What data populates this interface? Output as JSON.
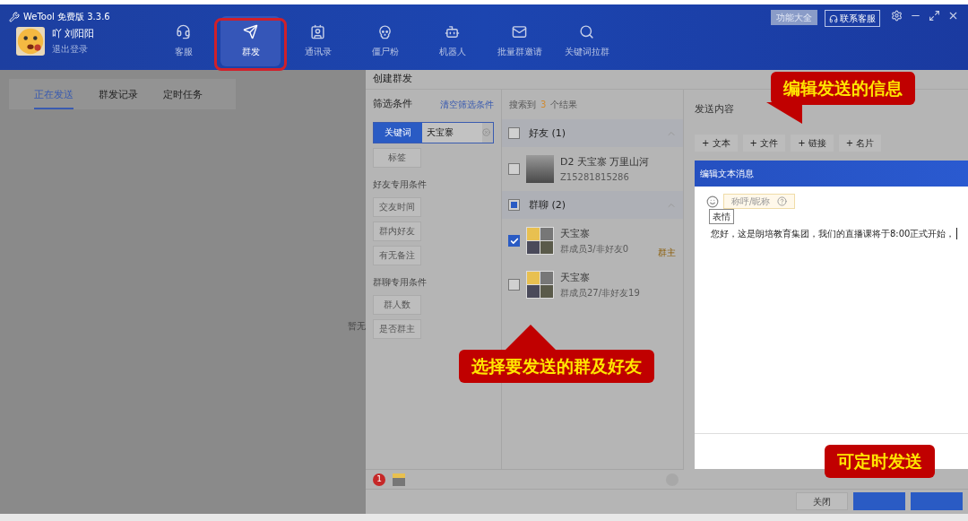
{
  "window": {
    "title": "WeTool 免费版 3.3.6"
  },
  "user": {
    "name": "吖 刘阳阳",
    "logout": "退出登录"
  },
  "nav": [
    {
      "label": "客服",
      "selected": false
    },
    {
      "label": "群发",
      "selected": true
    },
    {
      "label": "通讯录",
      "selected": false
    },
    {
      "label": "僵尸粉",
      "selected": false
    },
    {
      "label": "机器人",
      "selected": false
    },
    {
      "label": "批量群邀请",
      "selected": false
    },
    {
      "label": "关键词拉群",
      "selected": false
    }
  ],
  "header_buttons": {
    "features": "功能大全",
    "support": "联系客服"
  },
  "left_tabs": [
    {
      "label": "正在发送",
      "selected": true
    },
    {
      "label": "群发记录",
      "selected": false
    },
    {
      "label": "定时任务",
      "selected": false
    }
  ],
  "empty_text": "暂无",
  "panel": {
    "title": "创建群发"
  },
  "filters": {
    "title": "筛选条件",
    "clear": "清空筛选条件",
    "keyword": {
      "label": "关键词",
      "value": "天宝寨"
    },
    "tag": "标签",
    "sections": [
      {
        "title": "好友专用条件",
        "buttons": [
          "交友时间",
          "群内好友",
          "有无备注"
        ]
      },
      {
        "title": "群聊专用条件",
        "buttons": [
          "群人数",
          "是否群主"
        ]
      }
    ]
  },
  "results": {
    "prefix": "搜索到",
    "count": "3",
    "suffix": "个结果",
    "groups": [
      {
        "title": "好友 (1)",
        "checked": false,
        "partial": false,
        "expanded": true,
        "items": [
          {
            "name": "D2 天宝寨 万里山河",
            "sub": "Z15281815286",
            "checked": false,
            "kind": "photo"
          }
        ]
      },
      {
        "title": "群聊 (2)",
        "checked": false,
        "partial": true,
        "expanded": true,
        "items": [
          {
            "name": "天宝寨",
            "sub": "群成员3/非好友0",
            "checked": true,
            "kind": "group",
            "owner": "群主"
          },
          {
            "name": "天宝寨",
            "sub": "群成员27/非好友19",
            "checked": false,
            "kind": "group"
          }
        ]
      }
    ]
  },
  "send": {
    "title": "发送内容",
    "add_buttons": [
      "+ 文本",
      "+ 文件",
      "+ 链接",
      "+ 名片"
    ],
    "editor": {
      "title": "编辑文本消息",
      "tooltip": "表情",
      "chip": "称呼/昵称",
      "message": "您好，这是朗培教育集团，我们的直播课将于8:00正式开始，"
    }
  },
  "footer": {
    "badge": "1",
    "buttons": [
      {
        "label": "关闭",
        "kind": "plain"
      },
      {
        "kind": "primary"
      },
      {
        "kind": "primary"
      }
    ]
  },
  "annotations": [
    {
      "kind": "highlight"
    },
    {
      "kind": "callout",
      "text": "编辑发送的信息"
    },
    {
      "kind": "callout",
      "text": "选择要发送的群及好友"
    },
    {
      "kind": "callout",
      "text": "可定时发送"
    }
  ]
}
